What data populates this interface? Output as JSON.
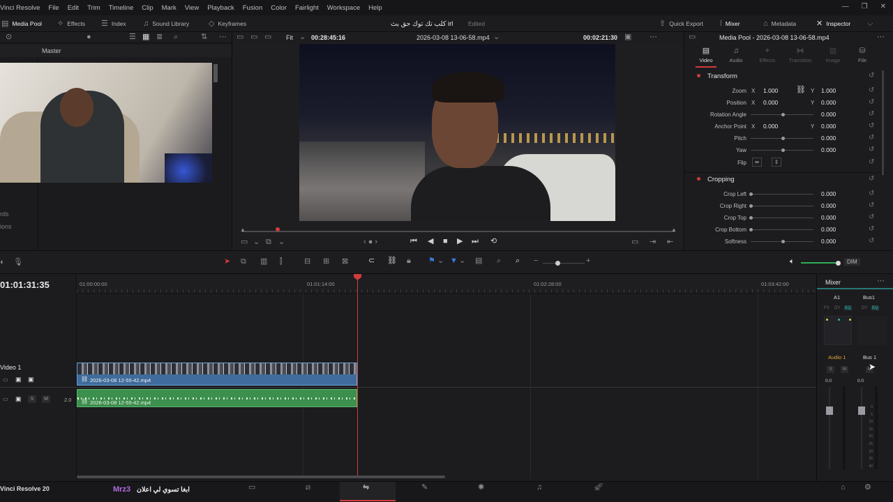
{
  "menu": {
    "items": [
      "Vinci Resolve",
      "File",
      "Edit",
      "Trim",
      "Timeline",
      "Clip",
      "Mark",
      "View",
      "Playback",
      "Fusion",
      "Color",
      "Fairlight",
      "Workspace",
      "Help"
    ]
  },
  "toolbar": {
    "media_pool": "Media Pool",
    "effects": "Effects",
    "index": "Index",
    "sound_library": "Sound Library",
    "keyframes": "Keyframes",
    "project_title": "كلب تك توك حق بث irl",
    "edited": "Edited",
    "quick_export": "Quick Export",
    "mixer": "Mixer",
    "metadata": "Metadata",
    "inspector": "Inspector"
  },
  "media_pool": {
    "bin": "Master",
    "side_labels": [
      "rds",
      "ions"
    ]
  },
  "viewer": {
    "fit": "Fit",
    "timecode": "00:28:45:16",
    "clip_name": "2026-03-08 13-06-58.mp4",
    "duration": "00:02:21:30",
    "playhead_fraction": 0.082
  },
  "inspector": {
    "title": "Media Pool - 2026-03-08 13-06-58.mp4",
    "tabs": [
      "Video",
      "Audio",
      "Effects",
      "Transition",
      "Image",
      "File"
    ],
    "transform_title": "Transform",
    "zoom_label": "Zoom",
    "zoom_x": "1.000",
    "zoom_y": "1.000",
    "position_label": "Position",
    "position_x": "0.000",
    "position_y": "0.000",
    "rotation_label": "Rotation Angle",
    "rotation": "0.000",
    "anchor_label": "Anchor Point",
    "anchor_x": "0.000",
    "anchor_y": "0.000",
    "pitch_label": "Pitch",
    "pitch": "0.000",
    "yaw_label": "Yaw",
    "yaw": "0.000",
    "flip_label": "Flip",
    "x": "X",
    "y": "Y",
    "cropping_title": "Cropping",
    "crop_left_label": "Crop Left",
    "crop_left": "0.000",
    "crop_right_label": "Crop Right",
    "crop_right": "0.000",
    "crop_top_label": "Crop Top",
    "crop_top": "0.000",
    "crop_bottom_label": "Crop Bottom",
    "crop_bottom": "0.000",
    "softness_label": "Softness",
    "softness": "0.000"
  },
  "timeline": {
    "timecode": "01:01:31:35",
    "ruler": [
      "01:00:00:00",
      "01:01:14:00",
      "01:02:28:00",
      "01:03:42:00"
    ],
    "video_track": "Video 1",
    "video_clip": "2026-03-08 12-55-42.mp4",
    "audio_clip": "2026-03-08 12-55-42.mp4",
    "audio_level": "2.0",
    "dim": "DIM",
    "s": "S",
    "m": "M"
  },
  "mixer": {
    "title": "Mixer",
    "a1": "A1",
    "bus1": "Bus1",
    "fx": "FX",
    "dy": "DY",
    "eq": "EQ",
    "audio1": "Audio 1",
    "bus_1": "Bus 1",
    "db_left": "0.0",
    "db_right": "0.0",
    "scale": [
      "0",
      "5",
      "10",
      "15",
      "20",
      "25",
      "30",
      "35",
      "40",
      "50"
    ]
  },
  "footer": {
    "app": "Vinci Resolve 20",
    "watermark_name": "Mrz3",
    "watermark_text": "ابغا تسوي لي اعلان"
  },
  "colors": {
    "accent_red": "#d33b3b",
    "clip_blue": "#3f6c9c",
    "clip_green": "#3c8f4d",
    "eq_teal": "#2fb8b0"
  }
}
